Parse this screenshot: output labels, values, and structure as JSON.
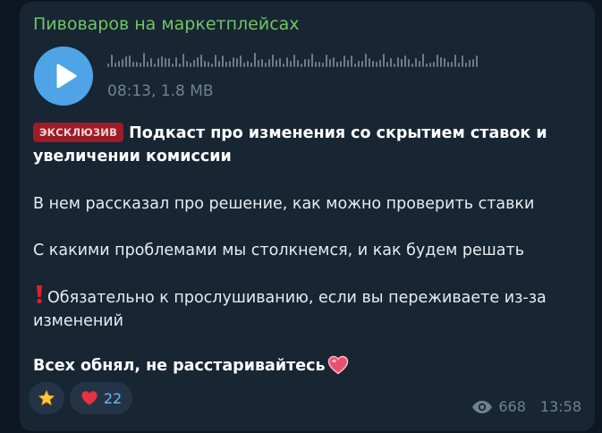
{
  "post": {
    "channel_name": "Пивоваров на маркетплейсах",
    "audio": {
      "duration": "08:13",
      "size": "1.8 MB",
      "meta_text": "08:13, 1.8 MB"
    },
    "badge_label": "ЭКСКЛЮЗИВ",
    "headline": "Подкаст про изменения со скрытием ставок и увеличении комиссии",
    "paragraph1": "В нем рассказал про решение, как можно проверить ставки",
    "paragraph2": "С какими проблемами мы столкнемся, и как будем решать",
    "paragraph3": "Обязательно к прослушиванию, если вы переживаете из-за изменений",
    "closing": "Всех обнял, не расстаривайтесь",
    "reactions": [
      {
        "icon": "star-icon",
        "count": ""
      },
      {
        "icon": "heart-icon",
        "count": "22"
      }
    ],
    "views": "668",
    "time": "13:58"
  },
  "colors": {
    "background": "#0e1621",
    "bubble": "#182533",
    "channel_name": "#71c563",
    "accent": "#4ea4e6",
    "badge": "#9c1c27",
    "meta": "#6f8294"
  }
}
